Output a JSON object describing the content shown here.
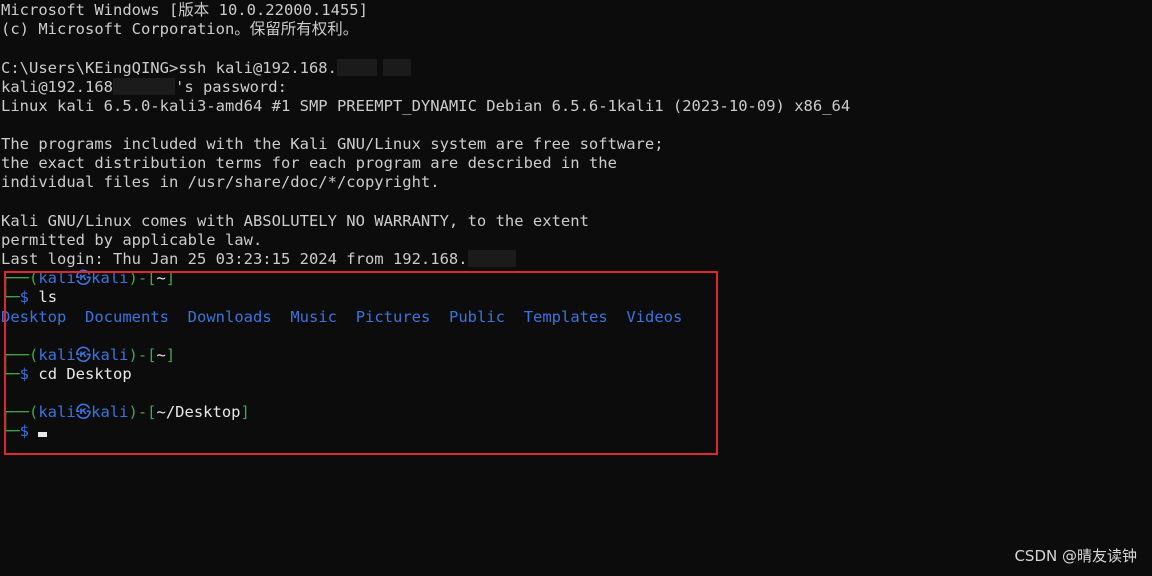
{
  "header": {
    "os_banner": "Microsoft Windows [版本 10.0.22000.1455]",
    "copyright": "(c) Microsoft Corporation。保留所有权利。"
  },
  "session": {
    "cmd_prompt": "C:\\Users\\KEingQING>",
    "ssh_command": "ssh kali@192.168.",
    "password_prefix": "kali@192.168",
    "password_suffix": "'s password:",
    "uname": "Linux kali 6.5.0-kali3-amd64 #1 SMP PREEMPT_DYNAMIC Debian 6.5.6-1kali1 (2023-10-09) x86_64"
  },
  "motd": {
    "line1": "The programs included with the Kali GNU/Linux system are free software;",
    "line2": "the exact distribution terms for each program are described in the",
    "line3": "individual files in /usr/share/doc/*/copyright.",
    "line4": "Kali GNU/Linux comes with ABSOLUTELY NO WARRANTY, to the extent",
    "line5": "permitted by applicable law.",
    "last_login": "Last login: Thu Jan 25 03:23:15 2024 from 192.168."
  },
  "prompt": {
    "user": "kali",
    "at_symbol": "㉿",
    "host": "kali",
    "dollar": "$"
  },
  "blocks": [
    {
      "path": "~",
      "command": "ls"
    },
    {
      "path": "~",
      "command": "cd Desktop"
    },
    {
      "path": "~/Desktop",
      "command": ""
    }
  ],
  "ls_output": [
    "Desktop",
    "Documents",
    "Downloads",
    "Music",
    "Pictures",
    "Public",
    "Templates",
    "Videos"
  ],
  "watermark": "CSDN @晴友读钟",
  "colors": {
    "background": "#0c0c0c",
    "text": "#cccccc",
    "prompt_green": "#3fa84a",
    "prompt_blue": "#3a74e0",
    "highlight_red": "#e0262e"
  }
}
